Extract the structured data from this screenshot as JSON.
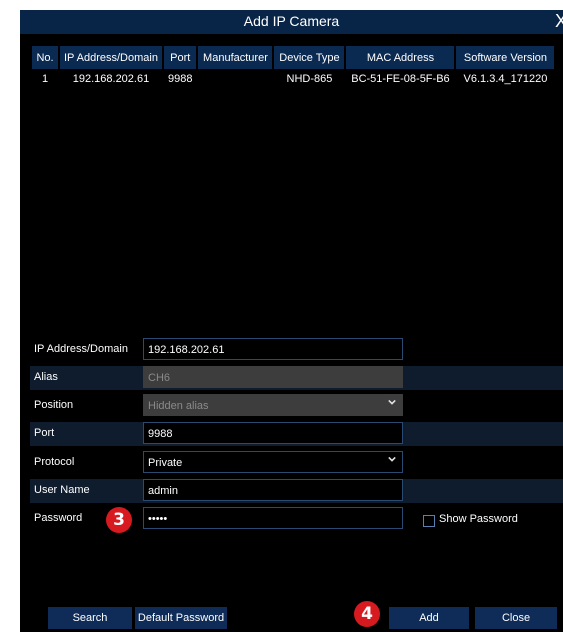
{
  "dialog": {
    "title": "Add IP Camera",
    "close_glyph": "X"
  },
  "table": {
    "headers": [
      "No.",
      "IP Address/Domain",
      "Port",
      "Manufacturer",
      "Device Type",
      "MAC Address",
      "Software Version"
    ],
    "rows": [
      [
        "1",
        "192.168.202.61",
        "9988",
        "",
        "NHD-865",
        "BC-51-FE-08-5F-B6",
        "V6.1.3.4_171220"
      ]
    ]
  },
  "form": {
    "ip": {
      "label": "IP Address/Domain",
      "value": "192.168.202.61"
    },
    "alias": {
      "label": "Alias",
      "value": "CH6"
    },
    "position": {
      "label": "Position",
      "value": "Hidden alias"
    },
    "port": {
      "label": "Port",
      "value": "9988"
    },
    "protocol": {
      "label": "Protocol",
      "value": "Private"
    },
    "username": {
      "label": "User Name",
      "value": "admin"
    },
    "password": {
      "label": "Password",
      "value": "•••••"
    },
    "show_password": {
      "label": "Show Password",
      "checked": false
    }
  },
  "buttons": {
    "search": "Search",
    "default_password": "Default Password",
    "add": "Add",
    "close": "Close"
  },
  "annotations": {
    "badge_3": "3",
    "badge_4": "4"
  },
  "colors": {
    "title_bar": "#082548",
    "header_cell": "#0b2a52",
    "button": "#0e2c57",
    "badge": "#d71920",
    "background": "#000000"
  },
  "icons": {
    "close": "close-icon",
    "dropdown": "chevron-down-icon",
    "checkbox": "checkbox-icon"
  }
}
